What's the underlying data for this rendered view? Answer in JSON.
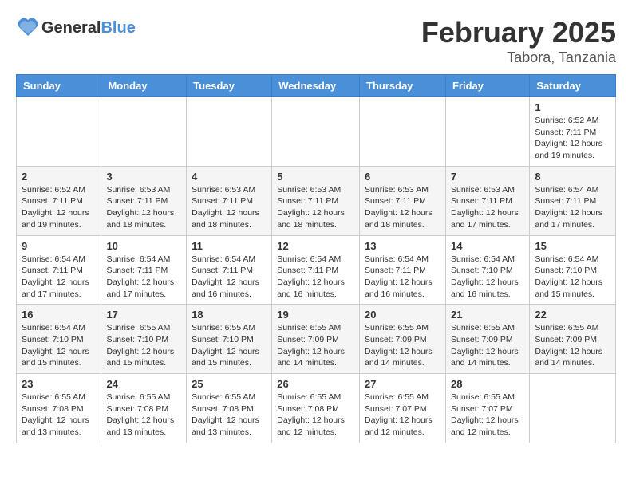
{
  "header": {
    "logo": {
      "general": "General",
      "blue": "Blue"
    },
    "month": "February 2025",
    "location": "Tabora, Tanzania"
  },
  "weekdays": [
    "Sunday",
    "Monday",
    "Tuesday",
    "Wednesday",
    "Thursday",
    "Friday",
    "Saturday"
  ],
  "weeks": [
    [
      {
        "day": "",
        "info": ""
      },
      {
        "day": "",
        "info": ""
      },
      {
        "day": "",
        "info": ""
      },
      {
        "day": "",
        "info": ""
      },
      {
        "day": "",
        "info": ""
      },
      {
        "day": "",
        "info": ""
      },
      {
        "day": "1",
        "info": "Sunrise: 6:52 AM\nSunset: 7:11 PM\nDaylight: 12 hours\nand 19 minutes."
      }
    ],
    [
      {
        "day": "2",
        "info": "Sunrise: 6:52 AM\nSunset: 7:11 PM\nDaylight: 12 hours\nand 19 minutes."
      },
      {
        "day": "3",
        "info": "Sunrise: 6:53 AM\nSunset: 7:11 PM\nDaylight: 12 hours\nand 18 minutes."
      },
      {
        "day": "4",
        "info": "Sunrise: 6:53 AM\nSunset: 7:11 PM\nDaylight: 12 hours\nand 18 minutes."
      },
      {
        "day": "5",
        "info": "Sunrise: 6:53 AM\nSunset: 7:11 PM\nDaylight: 12 hours\nand 18 minutes."
      },
      {
        "day": "6",
        "info": "Sunrise: 6:53 AM\nSunset: 7:11 PM\nDaylight: 12 hours\nand 18 minutes."
      },
      {
        "day": "7",
        "info": "Sunrise: 6:53 AM\nSunset: 7:11 PM\nDaylight: 12 hours\nand 17 minutes."
      },
      {
        "day": "8",
        "info": "Sunrise: 6:54 AM\nSunset: 7:11 PM\nDaylight: 12 hours\nand 17 minutes."
      }
    ],
    [
      {
        "day": "9",
        "info": "Sunrise: 6:54 AM\nSunset: 7:11 PM\nDaylight: 12 hours\nand 17 minutes."
      },
      {
        "day": "10",
        "info": "Sunrise: 6:54 AM\nSunset: 7:11 PM\nDaylight: 12 hours\nand 17 minutes."
      },
      {
        "day": "11",
        "info": "Sunrise: 6:54 AM\nSunset: 7:11 PM\nDaylight: 12 hours\nand 16 minutes."
      },
      {
        "day": "12",
        "info": "Sunrise: 6:54 AM\nSunset: 7:11 PM\nDaylight: 12 hours\nand 16 minutes."
      },
      {
        "day": "13",
        "info": "Sunrise: 6:54 AM\nSunset: 7:11 PM\nDaylight: 12 hours\nand 16 minutes."
      },
      {
        "day": "14",
        "info": "Sunrise: 6:54 AM\nSunset: 7:10 PM\nDaylight: 12 hours\nand 16 minutes."
      },
      {
        "day": "15",
        "info": "Sunrise: 6:54 AM\nSunset: 7:10 PM\nDaylight: 12 hours\nand 15 minutes."
      }
    ],
    [
      {
        "day": "16",
        "info": "Sunrise: 6:54 AM\nSunset: 7:10 PM\nDaylight: 12 hours\nand 15 minutes."
      },
      {
        "day": "17",
        "info": "Sunrise: 6:55 AM\nSunset: 7:10 PM\nDaylight: 12 hours\nand 15 minutes."
      },
      {
        "day": "18",
        "info": "Sunrise: 6:55 AM\nSunset: 7:10 PM\nDaylight: 12 hours\nand 15 minutes."
      },
      {
        "day": "19",
        "info": "Sunrise: 6:55 AM\nSunset: 7:09 PM\nDaylight: 12 hours\nand 14 minutes."
      },
      {
        "day": "20",
        "info": "Sunrise: 6:55 AM\nSunset: 7:09 PM\nDaylight: 12 hours\nand 14 minutes."
      },
      {
        "day": "21",
        "info": "Sunrise: 6:55 AM\nSunset: 7:09 PM\nDaylight: 12 hours\nand 14 minutes."
      },
      {
        "day": "22",
        "info": "Sunrise: 6:55 AM\nSunset: 7:09 PM\nDaylight: 12 hours\nand 14 minutes."
      }
    ],
    [
      {
        "day": "23",
        "info": "Sunrise: 6:55 AM\nSunset: 7:08 PM\nDaylight: 12 hours\nand 13 minutes."
      },
      {
        "day": "24",
        "info": "Sunrise: 6:55 AM\nSunset: 7:08 PM\nDaylight: 12 hours\nand 13 minutes."
      },
      {
        "day": "25",
        "info": "Sunrise: 6:55 AM\nSunset: 7:08 PM\nDaylight: 12 hours\nand 13 minutes."
      },
      {
        "day": "26",
        "info": "Sunrise: 6:55 AM\nSunset: 7:08 PM\nDaylight: 12 hours\nand 12 minutes."
      },
      {
        "day": "27",
        "info": "Sunrise: 6:55 AM\nSunset: 7:07 PM\nDaylight: 12 hours\nand 12 minutes."
      },
      {
        "day": "28",
        "info": "Sunrise: 6:55 AM\nSunset: 7:07 PM\nDaylight: 12 hours\nand 12 minutes."
      },
      {
        "day": "",
        "info": ""
      }
    ]
  ]
}
